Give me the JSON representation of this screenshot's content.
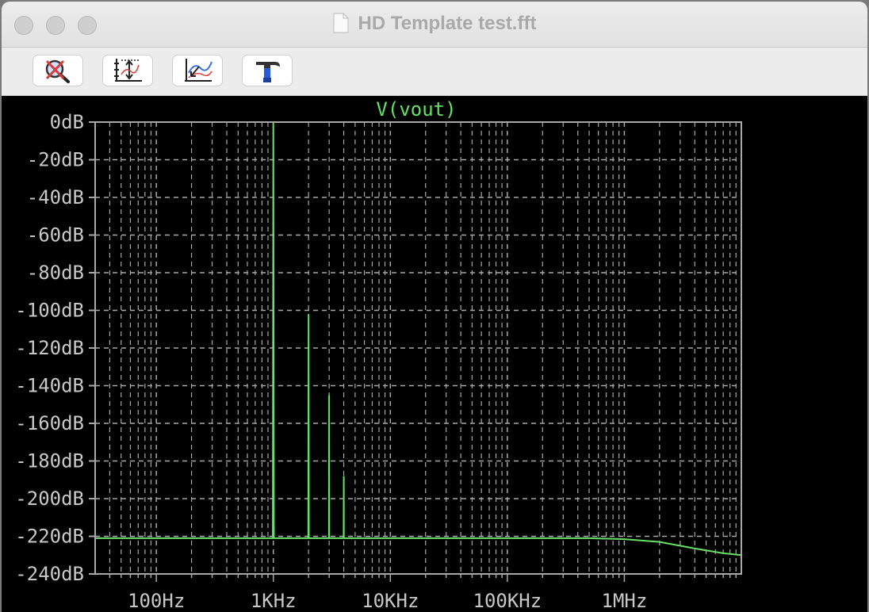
{
  "window": {
    "title": "HD Template test.fft"
  },
  "toolbar": {
    "buttons": [
      {
        "name": "zoom-cancel-button",
        "icon": "zoom-cancel-icon"
      },
      {
        "name": "autorange-y-button",
        "icon": "autorange-axes-icon"
      },
      {
        "name": "pick-trace-button",
        "icon": "pick-trace-icon"
      },
      {
        "name": "settings-button",
        "icon": "hammer-icon"
      }
    ]
  },
  "colors": {
    "trace": "#66e066",
    "grid": "#a8a8a8",
    "background": "#000000",
    "title": "#66e066"
  },
  "chart_data": {
    "type": "line",
    "title": "V(vout)",
    "xscale": "log",
    "xlim": [
      30,
      10000000
    ],
    "ylim": [
      -240,
      0
    ],
    "x_ticks": [
      "100Hz",
      "1KHz",
      "10KHz",
      "100KHz",
      "1MHz"
    ],
    "y_ticks": [
      "0dB",
      "-20dB",
      "-40dB",
      "-60dB",
      "-80dB",
      "-100dB",
      "-120dB",
      "-140dB",
      "-160dB",
      "-180dB",
      "-200dB",
      "-220dB",
      "-240dB"
    ],
    "grid": true,
    "series": [
      {
        "name": "V(vout)",
        "x": [
          30,
          100,
          500,
          990,
          1000,
          1010,
          1990,
          2000,
          2010,
          2990,
          3000,
          3010,
          3990,
          4000,
          4010,
          10000,
          100000,
          500000,
          1000000,
          2000000,
          4000000,
          7000000,
          10000000
        ],
        "y": [
          -221,
          -221,
          -221,
          -221,
          0,
          -221,
          -221,
          -102,
          -221,
          -221,
          -145,
          -221,
          -221,
          -188,
          -221,
          -221,
          -221,
          -221,
          -221.5,
          -223,
          -226.5,
          -229,
          -230
        ]
      }
    ]
  }
}
